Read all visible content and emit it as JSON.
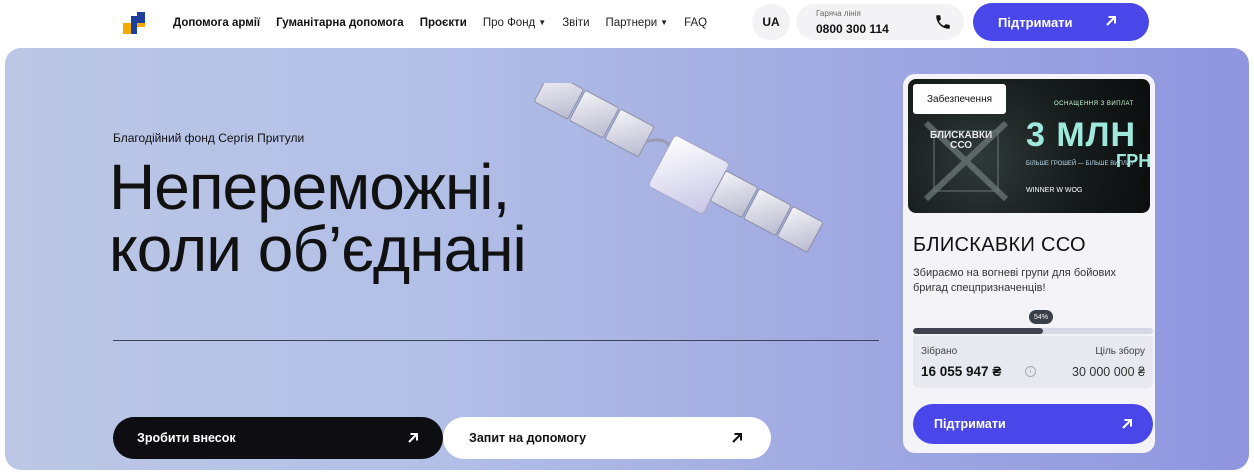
{
  "header": {
    "nav": [
      {
        "label": "Допомога армії",
        "bold": true
      },
      {
        "label": "Гуманітарна допомога",
        "bold": true
      },
      {
        "label": "Проєкти",
        "bold": true
      },
      {
        "label": "Про Фонд",
        "bold": false,
        "dropdown": true
      },
      {
        "label": "Звіти",
        "bold": false
      },
      {
        "label": "Партнери",
        "bold": false,
        "dropdown": true
      },
      {
        "label": "FAQ",
        "bold": false
      }
    ],
    "lang": "UA",
    "hotline_label": "Гаряча лінія",
    "hotline_number": "0800 300 114",
    "support_label": "Підтримати"
  },
  "hero": {
    "subtitle": "Благодійний фонд Сергія Притули",
    "title_line1": "Непереможні,",
    "title_line2": "коли об’єднані",
    "donate_label": "Зробити внесок",
    "help_label": "Запит на допомогу"
  },
  "card": {
    "badge": "Забезпечення",
    "banner_big": "3 МЛН",
    "banner_currency": "ГРН",
    "banner_top": "ОСНАЩЕННЯ З ВИПЛАТ",
    "banner_small": "БІЛЬШЕ ГРОШЕЙ — БІЛЬШЕ ВИПЛАТ",
    "banner_cco_line1": "БЛИСКАВКИ",
    "banner_cco_line2": "ССО",
    "banner_partners": "WINNER  W WOG",
    "title": "БЛИСКАВКИ ССО",
    "description": "Збираємо на вогневі групи для бойових бригад спецпризначенців!",
    "progress_label": "54%",
    "progress": 0.54,
    "collected_label": "Зібрано",
    "goal_label": "Ціль збору",
    "collected_value": "16 055 947 ₴",
    "goal_value": "30 000 000 ₴",
    "support_label": "Підтримати"
  },
  "colors": {
    "accent": "#4a47ea",
    "dark_button": "#0d0d12",
    "hero_start": "#bcc7e6",
    "hero_end": "#8f95df"
  }
}
